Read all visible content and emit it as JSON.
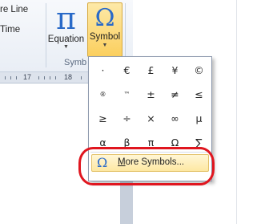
{
  "ribbon": {
    "left_commands": [
      "re Line",
      "Time"
    ],
    "equation": {
      "label": "Equation",
      "glyph": "π"
    },
    "symbol": {
      "label": "Symbol",
      "glyph": "Ω"
    },
    "group_label": "Symb"
  },
  "ruler": {
    "numbers": [
      "17",
      "18"
    ]
  },
  "symbol_menu": {
    "symbols": [
      "·",
      "€",
      "£",
      "¥",
      "©",
      "®",
      "™",
      "±",
      "≠",
      "≤",
      "≥",
      "÷",
      "×",
      "∞",
      "µ",
      "α",
      "β",
      "π",
      "Ω",
      "∑"
    ],
    "more_symbols": {
      "underlined_letter": "M",
      "rest": "ore Symbols..."
    }
  },
  "colors": {
    "accent_blue": "#2a6ac8",
    "symbol_button_bg": "#fbcf5e",
    "highlight_ring": "#e0161f"
  }
}
